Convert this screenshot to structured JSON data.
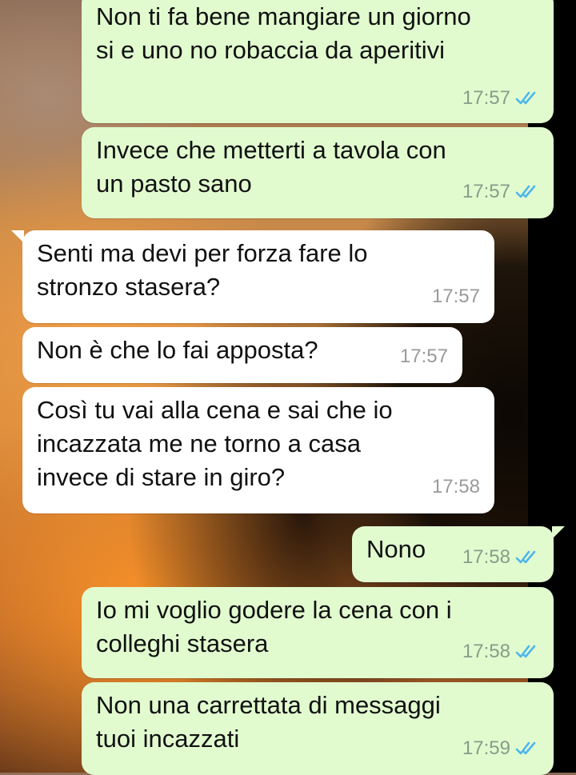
{
  "colors": {
    "outgoing_bubble": "#e1fbcf",
    "incoming_bubble": "#ffffff",
    "read_ticks": "#4fb6ec"
  },
  "messages": [
    {
      "direction": "outgoing",
      "text": "Non ti fa bene mangiare un giorno\nsi e uno no robaccia da aperitivi",
      "time": "17:57",
      "status_icon": "double-check-read-icon"
    },
    {
      "direction": "outgoing",
      "text": "Invece che metterti a tavola con\nun pasto sano",
      "time": "17:57",
      "status_icon": "double-check-read-icon"
    },
    {
      "direction": "incoming",
      "text": "Senti ma devi per forza fare lo\nstronzo stasera?",
      "time": "17:57"
    },
    {
      "direction": "incoming",
      "text": "Non è che lo fai apposta?",
      "time": "17:57"
    },
    {
      "direction": "incoming",
      "text": "Così tu vai alla cena e sai che io\nincazzata me ne torno a casa\ninvece di stare in giro?",
      "time": "17:58"
    },
    {
      "direction": "outgoing",
      "text": "Nono",
      "time": "17:58",
      "status_icon": "double-check-read-icon"
    },
    {
      "direction": "outgoing",
      "text": "Io mi voglio godere la cena con i\ncolleghi stasera",
      "time": "17:58",
      "status_icon": "double-check-read-icon"
    },
    {
      "direction": "outgoing",
      "text": "Non una carrettata di messaggi\ntuoi incazzati",
      "time": "17:59",
      "status_icon": "double-check-read-icon"
    }
  ]
}
